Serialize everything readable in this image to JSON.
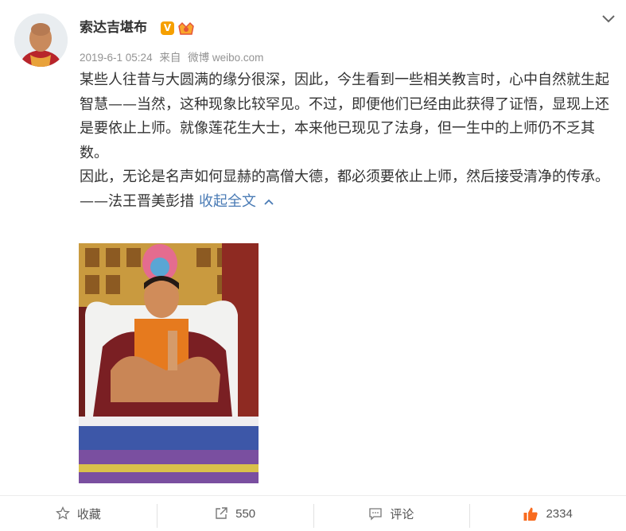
{
  "post": {
    "author": "索达吉堪布",
    "verified_badge": "V",
    "date": "2019-6-1 05:24",
    "source_prefix": "来自",
    "source": "微博 weibo.com",
    "paragraphs": [
      "某些人往昔与大圆满的缘分很深，因此，今生看到一些相关教言时，心中自然就生起智慧——当然，这种现象比较罕见。不过，即便他们已经由此获得了证悟，显现上还是要依止上师。就像莲花生大士，本来他已现见了法身，但一生中的上师仍不乏其数。",
      "因此，无论是名声如何显赫的高僧大德，都必须要依止上师，然后接受清净的传承。"
    ],
    "signature": "——法王晋美彭措",
    "collapse_label": "收起全文"
  },
  "actions": {
    "favorite_label": "收藏",
    "repost_count": "550",
    "comment_label": "评论",
    "like_count": "2334"
  },
  "colors": {
    "link": "#4a7bb5",
    "meta": "#939393",
    "like": "#f86b1f",
    "badge": "#f6a000"
  }
}
